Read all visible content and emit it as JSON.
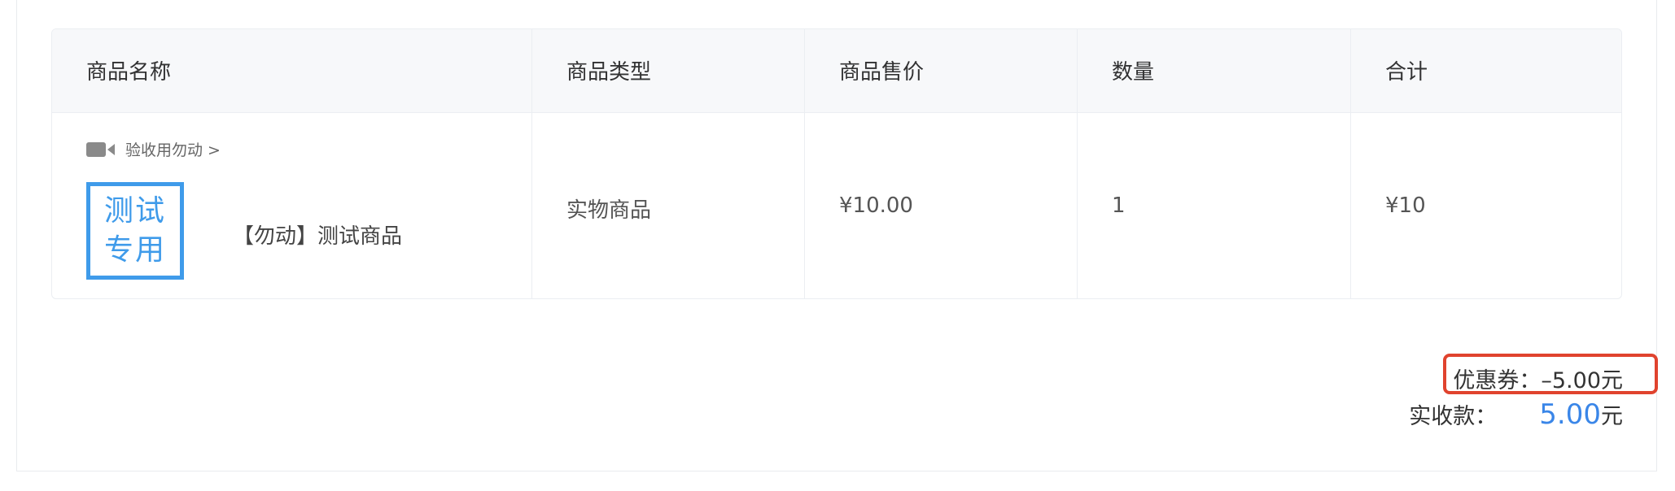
{
  "table": {
    "headers": [
      "商品名称",
      "商品类型",
      "商品售价",
      "数量",
      "合计"
    ],
    "row": {
      "shop_name": "验收用勿动 >",
      "thumbnail_text": [
        "测试",
        "专用"
      ],
      "product_name": "【勿动】测试商品",
      "product_type": "实物商品",
      "price": "¥10.00",
      "quantity": "1",
      "subtotal": "¥10"
    }
  },
  "summary": {
    "coupon": "优惠券：–5.00元",
    "received_label": "实收款：",
    "received_amount": "5.00",
    "received_unit": "元"
  },
  "colors": {
    "accent": "#3a86e8",
    "highlight_border": "#e0432e",
    "thumbnail": "#3f9bea"
  },
  "icons": {
    "shop": "video-camera-icon"
  }
}
